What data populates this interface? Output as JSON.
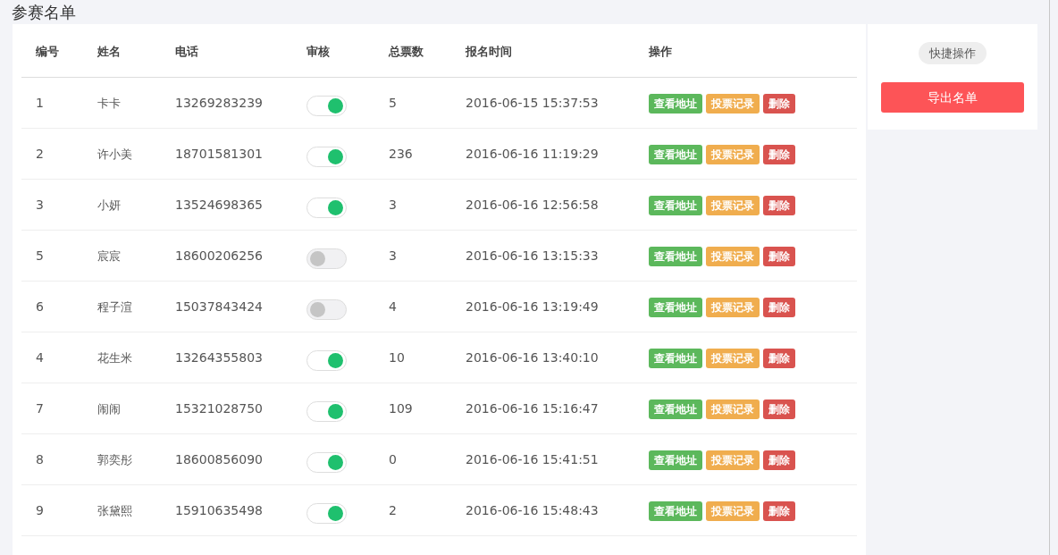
{
  "page_title": "参赛名单",
  "table": {
    "columns": [
      "编号",
      "姓名",
      "电话",
      "审核",
      "总票数",
      "报名时间",
      "操作"
    ],
    "rows": [
      {
        "id": "1",
        "name": "卡卡",
        "phone": "13269283239",
        "approved": true,
        "votes": "5",
        "time": "2016-06-15 15:37:53",
        "actions": [
          "查看地址",
          "投票记录",
          "删除"
        ]
      },
      {
        "id": "2",
        "name": "许小美",
        "phone": "18701581301",
        "approved": true,
        "votes": "236",
        "time": "2016-06-16 11:19:29",
        "actions": [
          "查看地址",
          "投票记录",
          "删除"
        ]
      },
      {
        "id": "3",
        "name": "小妍",
        "phone": "13524698365",
        "approved": true,
        "votes": "3",
        "time": "2016-06-16 12:56:58",
        "actions": [
          "查看地址",
          "投票记录",
          "删除"
        ]
      },
      {
        "id": "5",
        "name": "宸宸",
        "phone": "18600206256",
        "approved": false,
        "votes": "3",
        "time": "2016-06-16 13:15:33",
        "actions": [
          "查看地址",
          "投票记录",
          "删除"
        ]
      },
      {
        "id": "6",
        "name": "程子渲",
        "phone": "15037843424",
        "approved": false,
        "votes": "4",
        "time": "2016-06-16 13:19:49",
        "actions": [
          "查看地址",
          "投票记录",
          "删除"
        ]
      },
      {
        "id": "4",
        "name": "花生米",
        "phone": "13264355803",
        "approved": true,
        "votes": "10",
        "time": "2016-06-16 13:40:10",
        "actions": [
          "查看地址",
          "投票记录",
          "删除"
        ]
      },
      {
        "id": "7",
        "name": "闹闹",
        "phone": "15321028750",
        "approved": true,
        "votes": "109",
        "time": "2016-06-16 15:16:47",
        "actions": [
          "查看地址",
          "投票记录",
          "删除"
        ]
      },
      {
        "id": "8",
        "name": "郭奕彤",
        "phone": "18600856090",
        "approved": true,
        "votes": "0",
        "time": "2016-06-16 15:41:51",
        "actions": [
          "查看地址",
          "投票记录",
          "删除"
        ]
      },
      {
        "id": "9",
        "name": "张黛熙",
        "phone": "15910635498",
        "approved": true,
        "votes": "2",
        "time": "2016-06-16 15:48:43",
        "actions": [
          "查看地址",
          "投票记录",
          "删除"
        ]
      }
    ]
  },
  "side_panel": {
    "label": "快捷操作",
    "button": "导出名单"
  }
}
